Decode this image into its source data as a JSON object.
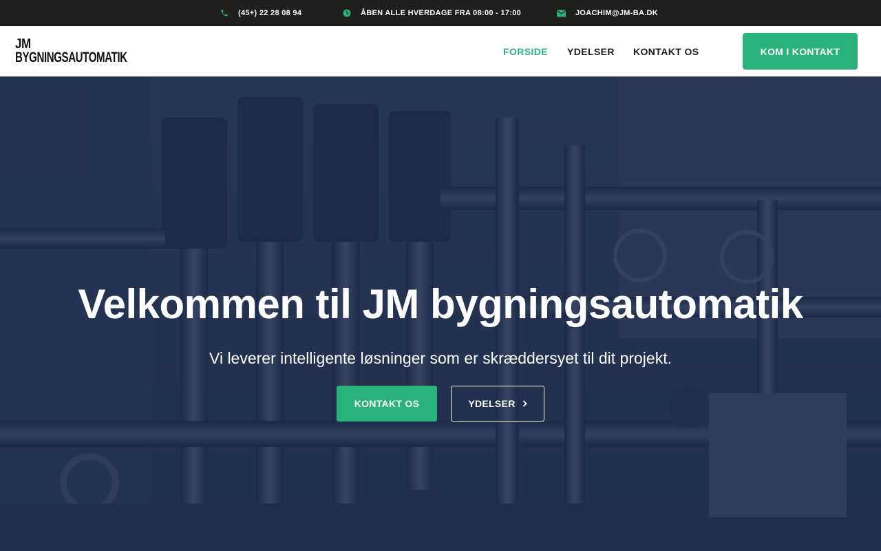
{
  "topbar": {
    "phone": "(45+) 22 28 08 94",
    "hours": "ÅBEN ALLE HVERDAGE FRA 08:00 - 17:00",
    "email": "JOACHIM@JM-BA.DK",
    "phone_icon": "phone-icon",
    "hours_icon": "clock-icon",
    "email_icon": "envelope-icon"
  },
  "logo": {
    "line1": "JM",
    "line2": "BYGNINGSAUTOMATIK"
  },
  "nav": {
    "items": [
      {
        "label": "FORSIDE",
        "active": true
      },
      {
        "label": "YDELSER",
        "active": false
      },
      {
        "label": "KONTAKT OS",
        "active": false
      }
    ],
    "cta_label": "KOM I KONTAKT"
  },
  "hero": {
    "title": "Velkommen til JM bygningsautomatik",
    "subtitle": "Vi leverer intelligente løsninger som er skræddersyet til dit projekt.",
    "primary_button": "KONTAKT OS",
    "secondary_button": "YDELSER",
    "secondary_icon": "chevron-right-icon"
  },
  "colors": {
    "accent": "#2ab27b",
    "topbar_bg": "#1f1f1d",
    "hero_overlay": "#1c2a45",
    "text_dark": "#1a1a1a"
  }
}
